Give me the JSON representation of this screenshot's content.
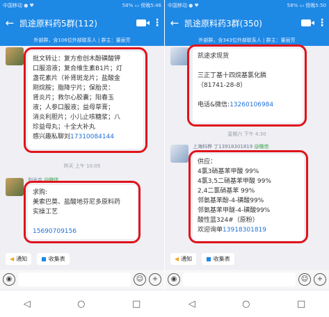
{
  "left": {
    "status_left": "中国移动 ● ♥",
    "status_right": "58% ▭ 傍晚5:46",
    "title": "凯途原料药5群(112)",
    "banner": "外部群，含106位外部联系人 | 群主：董丽芳",
    "msg1_lines": [
      "批文转让：复方愈创木酚磺酸钾",
      "口服溶液；复合维生素B1片；灯",
      "盏花素片（补肾斑龙片；盐酸金",
      "刚烷胺；脂降宁片；保胎灵：",
      "肾炎片；救尔心胶囊；阳春玉",
      "液；人参口服液；益母草膏；",
      "消炎利胆片；小儿止咳糖浆；八",
      "珍益母丸；十全大补丸"
    ],
    "msg1_contact": "感兴趣私聊刘",
    "msg1_phone": "17310084144",
    "time": "昨天 上午 10:05",
    "sender": "刘光合",
    "sender_tag": "@微信",
    "msg2_lines": [
      "求购:",
      "美索巴莫、盐酸地芬尼多原料药",
      "实操工艺"
    ],
    "msg2_phone": "15690709156"
  },
  "right": {
    "status_left": "中国移动 ● ♥",
    "status_right": "58% ▭ 傍晚5:50",
    "title": "凯途原料药3群(350)",
    "banner": "外部群，含343位外部联系人 | 群主：董丽芳",
    "msg1_lines": [
      "凯途求现货",
      "",
      "三正丁基十四烷基氯化膦",
      "（81741-28-8）",
      ""
    ],
    "msg1_contact": "电话&微信:",
    "msg1_phone": "13260106984",
    "time": "星期六 下午 4:30",
    "sender": "上海科桦 丁13918301819",
    "sender_tag": "@微信",
    "msg2_lines": [
      "供应：",
      "4氯3硝基苯甲酸 99%",
      "4氯3,5二硝基苯甲酸 99%",
      "2,4二氯硝基苯 99%",
      "邻氨基苯酚-4-磺酸99%",
      "邻氨基苯甲醚-4-磺酸99%",
      "酸性蓝324#（原粉）"
    ],
    "msg2_contact": "欢迎询单",
    "msg2_phone": "13918301819"
  },
  "quick": {
    "notice": "通知",
    "form": "收集表"
  },
  "nav": {
    "back": "◁",
    "home": "○",
    "recent": "□"
  },
  "icons": {
    "back": "←",
    "more": "⋮",
    "voice": "◉",
    "emoji": "☺",
    "plus": "+"
  }
}
